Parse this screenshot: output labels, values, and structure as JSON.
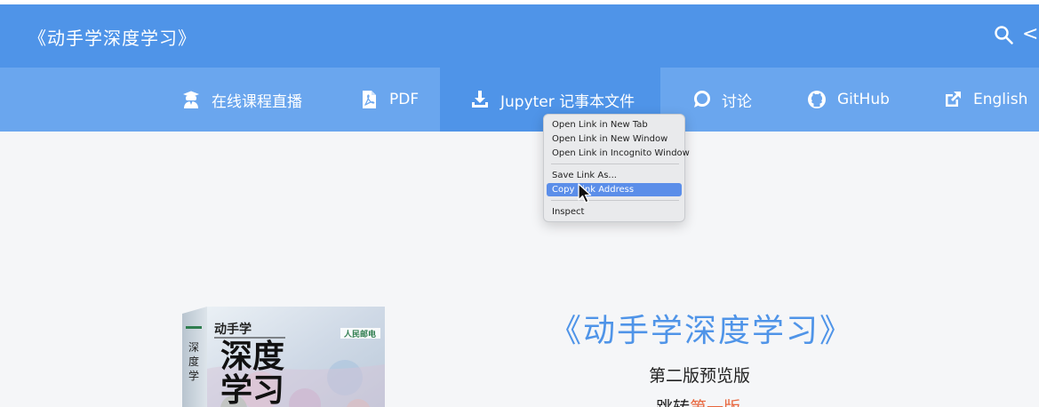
{
  "header": {
    "title": "《动手学深度学习》",
    "share_glyph": "<"
  },
  "nav": {
    "items": [
      {
        "label": "在线课程直播",
        "icon": "graduate-icon"
      },
      {
        "label": "PDF",
        "icon": "pdf-icon"
      },
      {
        "label": "Jupyter 记事本文件",
        "icon": "download-icon"
      },
      {
        "label": "讨论",
        "icon": "discuss-icon"
      },
      {
        "label": "GitHub",
        "icon": "github-icon"
      },
      {
        "label": "English",
        "icon": "external-link-icon"
      }
    ]
  },
  "context_menu": {
    "items": [
      "Open Link in New Tab",
      "Open Link in New Window",
      "Open Link in Incognito Window",
      "Save Link As...",
      "Copy Link Address",
      "Inspect"
    ],
    "highlighted": "Copy Link Address"
  },
  "hero": {
    "title": "《动手学深度学习》",
    "subtitle": "第二版预览版",
    "link_prefix": "跳转",
    "link_text": "第一版"
  },
  "book": {
    "cover_title": "深度学习",
    "cover_small": "动手学",
    "publisher": "人民邮电"
  },
  "colors": {
    "header": "#4f94e8",
    "navbar": "#6aa6ee",
    "accent": "#e8663d"
  }
}
